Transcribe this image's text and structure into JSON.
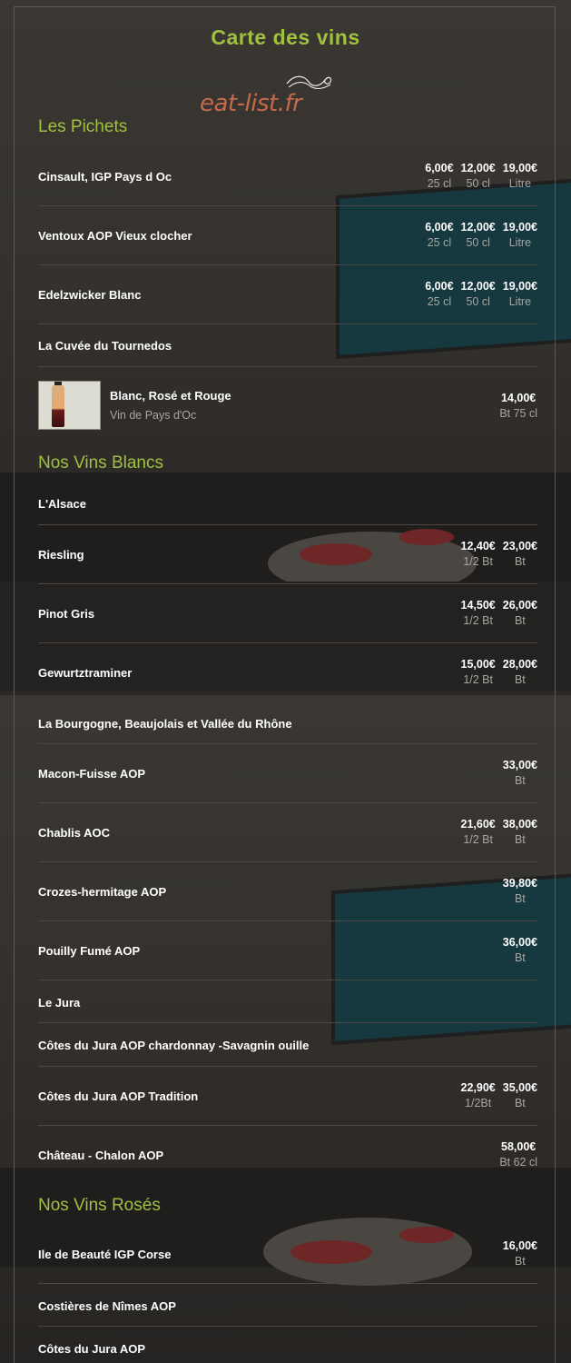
{
  "page": {
    "title": "Carte des vins",
    "logo_text": "eat-list.fr"
  },
  "colors": {
    "accent": "#a0c040",
    "logo": "#c46a4a",
    "muted": "#a8a6a3",
    "divider": "#4a4744"
  },
  "sections": {
    "pichets": {
      "title": "Les Pichets",
      "rows": [
        {
          "name": "Cinsault, IGP Pays d Oc",
          "prices": [
            {
              "v": "6,00€",
              "u": "25 cl"
            },
            {
              "v": "12,00€",
              "u": "50 cl"
            },
            {
              "v": "19,00€",
              "u": "Litre"
            }
          ]
        },
        {
          "name": "Ventoux AOP Vieux clocher",
          "prices": [
            {
              "v": "6,00€",
              "u": "25 cl"
            },
            {
              "v": "12,00€",
              "u": "50 cl"
            },
            {
              "v": "19,00€",
              "u": "Litre"
            }
          ]
        },
        {
          "name": "Edelzwicker Blanc",
          "prices": [
            {
              "v": "6,00€",
              "u": "25 cl"
            },
            {
              "v": "12,00€",
              "u": "50 cl"
            },
            {
              "v": "19,00€",
              "u": "Litre"
            }
          ]
        },
        {
          "name": "La Cuvée du Tournedos"
        },
        {
          "name": "Blanc, Rosé et Rouge",
          "subtitle": "Vin de Pays d'Oc",
          "image_icon": "wine-bottle-thumbnail",
          "prices": [
            {
              "v": "14,00€",
              "u": "Bt 75 cl"
            }
          ]
        }
      ]
    },
    "blancs": {
      "title": "Nos Vins Blancs",
      "rows": [
        {
          "name": "L'Alsace"
        },
        {
          "name": "Riesling",
          "prices": [
            {
              "v": "12,40€",
              "u": "1/2 Bt"
            },
            {
              "v": "23,00€",
              "u": "Bt"
            }
          ]
        },
        {
          "name": "Pinot Gris",
          "prices": [
            {
              "v": "14,50€",
              "u": "1/2 Bt"
            },
            {
              "v": "26,00€",
              "u": "Bt"
            }
          ]
        },
        {
          "name": "Gewurtztraminer",
          "prices": [
            {
              "v": "15,00€",
              "u": "1/2 Bt"
            },
            {
              "v": "28,00€",
              "u": "Bt"
            }
          ]
        },
        {
          "name": "La Bourgogne, Beaujolais et Vallée du Rhône"
        },
        {
          "name": "Macon-Fuisse AOP",
          "prices": [
            {
              "v": "33,00€",
              "u": "Bt"
            }
          ]
        },
        {
          "name": "Chablis AOC",
          "prices": [
            {
              "v": "21,60€",
              "u": "1/2 Bt"
            },
            {
              "v": "38,00€",
              "u": "Bt"
            }
          ]
        },
        {
          "name": "Crozes-hermitage AOP",
          "prices": [
            {
              "v": "39,80€",
              "u": "Bt"
            }
          ]
        },
        {
          "name": "Pouilly Fumé AOP",
          "prices": [
            {
              "v": "36,00€",
              "u": "Bt"
            }
          ]
        },
        {
          "name": "Le Jura"
        },
        {
          "name": "Côtes du Jura AOP chardonnay -Savagnin ouille"
        },
        {
          "name": "Côtes du Jura AOP Tradition",
          "prices": [
            {
              "v": "22,90€",
              "u": "1/2Bt"
            },
            {
              "v": "35,00€",
              "u": "Bt"
            }
          ]
        },
        {
          "name": "Château - Chalon AOP",
          "prices": [
            {
              "v": "58,00€",
              "u": "Bt 62 cl"
            }
          ]
        }
      ]
    },
    "roses": {
      "title": "Nos Vins Rosés",
      "rows": [
        {
          "name": "Ile de Beauté IGP Corse",
          "prices": [
            {
              "v": "16,00€",
              "u": "Bt"
            }
          ]
        },
        {
          "name": "Costières de Nîmes AOP"
        },
        {
          "name": "Côtes du Jura AOP"
        }
      ]
    }
  }
}
